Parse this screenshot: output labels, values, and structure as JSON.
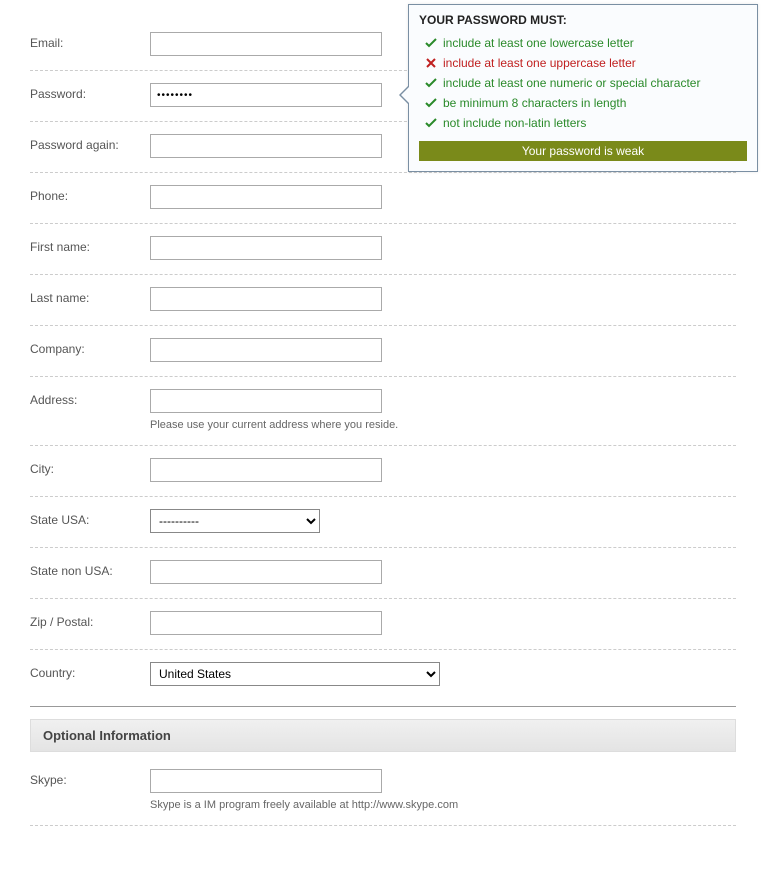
{
  "form": {
    "email": {
      "label": "Email:",
      "value": ""
    },
    "password": {
      "label": "Password:",
      "value": "••••••••"
    },
    "password_again": {
      "label": "Password again:",
      "value": ""
    },
    "phone": {
      "label": "Phone:",
      "value": ""
    },
    "first_name": {
      "label": "First name:",
      "value": ""
    },
    "last_name": {
      "label": "Last name:",
      "value": ""
    },
    "company": {
      "label": "Company:",
      "value": ""
    },
    "address": {
      "label": "Address:",
      "value": "",
      "hint": "Please use your current address where you reside."
    },
    "city": {
      "label": "City:",
      "value": ""
    },
    "state_usa": {
      "label": "State USA:",
      "selected": "----------"
    },
    "state_non_usa": {
      "label": "State non USA:",
      "value": ""
    },
    "zip": {
      "label": "Zip / Postal:",
      "value": ""
    },
    "country": {
      "label": "Country:",
      "selected": "United States"
    }
  },
  "optional_section": {
    "title": "Optional Information",
    "skype": {
      "label": "Skype:",
      "value": "",
      "hint": "Skype is a IM program freely available at http://www.skype.com"
    }
  },
  "password_rules": {
    "title": "YOUR PASSWORD MUST:",
    "rules": [
      {
        "text": "include at least one lowercase letter",
        "pass": true
      },
      {
        "text": "include at least one uppercase letter",
        "pass": false
      },
      {
        "text": "include at least one numeric or special character",
        "pass": true
      },
      {
        "text": "be minimum 8 characters in length",
        "pass": true
      },
      {
        "text": "not include non-latin letters",
        "pass": true
      }
    ],
    "strength_text": "Your password is weak"
  }
}
